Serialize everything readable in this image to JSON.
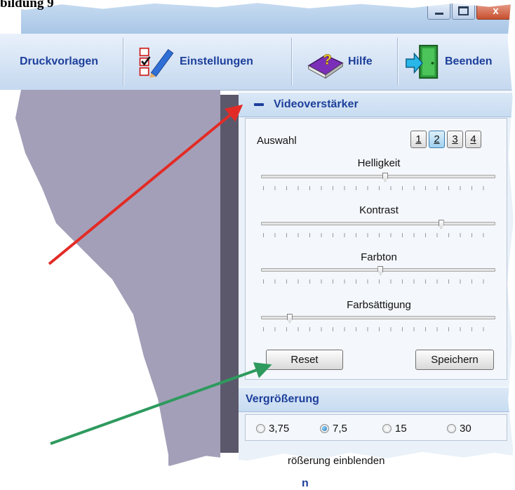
{
  "document": {
    "heading": "bildung 9"
  },
  "toolbar": {
    "items": [
      {
        "label": "Druckvorlagen"
      },
      {
        "label": "Einstellungen"
      },
      {
        "label": "Hilfe"
      },
      {
        "label": "Beenden"
      }
    ]
  },
  "video_section": {
    "title": "Videoverstärker",
    "auswahl_label": "Auswahl",
    "presets": [
      "1",
      "2",
      "3",
      "4"
    ],
    "active_preset": "2",
    "sliders": [
      {
        "label": "Helligkeit",
        "value": 0.53
      },
      {
        "label": "Kontrast",
        "value": 0.77
      },
      {
        "label": "Farbton",
        "value": 0.51
      },
      {
        "label": "Farbsättigung",
        "value": 0.12
      }
    ],
    "reset_label": "Reset",
    "save_label": "Speichern"
  },
  "zoom_section": {
    "title": "Vergrößerung",
    "options": [
      "3,75",
      "7,5",
      "15",
      "30"
    ],
    "selected": "7,5",
    "checkbox_label": "rößerung einblenden",
    "next_section_fragment": "n"
  },
  "colors": {
    "accent": "#1d3f9b",
    "red_arrow": "#e32b26",
    "green_arrow": "#2e9a5e"
  }
}
